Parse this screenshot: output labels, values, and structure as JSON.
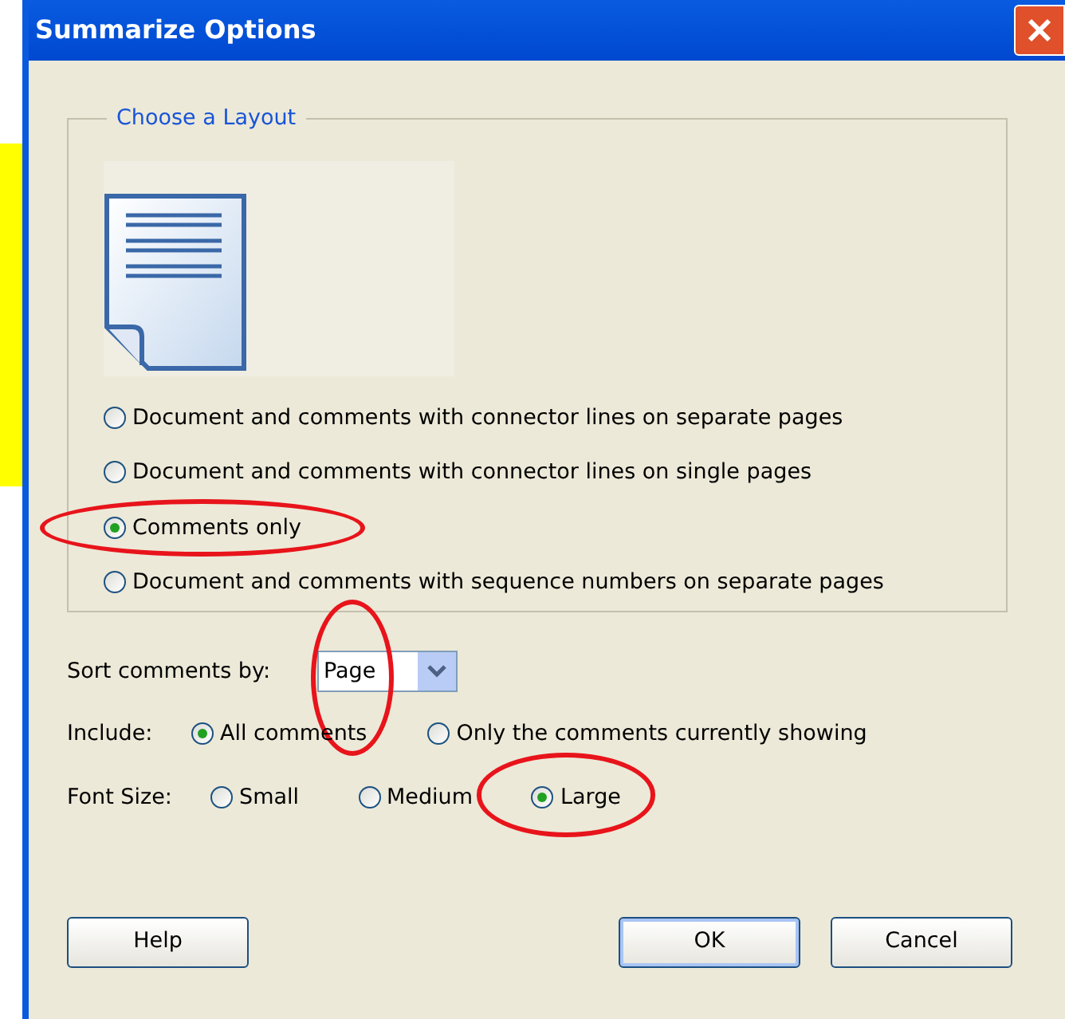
{
  "window": {
    "title": "Summarize Options"
  },
  "layout_group": {
    "title": "Choose a Layout",
    "options": [
      {
        "label": "Document and comments with connector lines on separate pages",
        "selected": false,
        "circled": false
      },
      {
        "label": "Document and comments with connector lines on single pages",
        "selected": false,
        "circled": false
      },
      {
        "label": "Comments only",
        "selected": true,
        "circled": true
      },
      {
        "label": "Document and comments with sequence numbers on separate pages",
        "selected": false,
        "circled": false
      }
    ]
  },
  "sort": {
    "label": "Sort comments by:",
    "value": "Page",
    "circled": true
  },
  "include": {
    "label": "Include:",
    "options": [
      {
        "label": "All comments",
        "selected": true,
        "circled": false
      },
      {
        "label": "Only the comments currently showing",
        "selected": false,
        "circled": false
      }
    ]
  },
  "font_size": {
    "label": "Font Size:",
    "options": [
      {
        "label": "Small",
        "selected": false,
        "circled": false
      },
      {
        "label": "Medium",
        "selected": false,
        "circled": false
      },
      {
        "label": "Large",
        "selected": true,
        "circled": true
      }
    ]
  },
  "buttons": [
    {
      "label": "Help",
      "default": false
    },
    {
      "label": "OK",
      "default": true
    },
    {
      "label": "Cancel",
      "default": false
    }
  ]
}
